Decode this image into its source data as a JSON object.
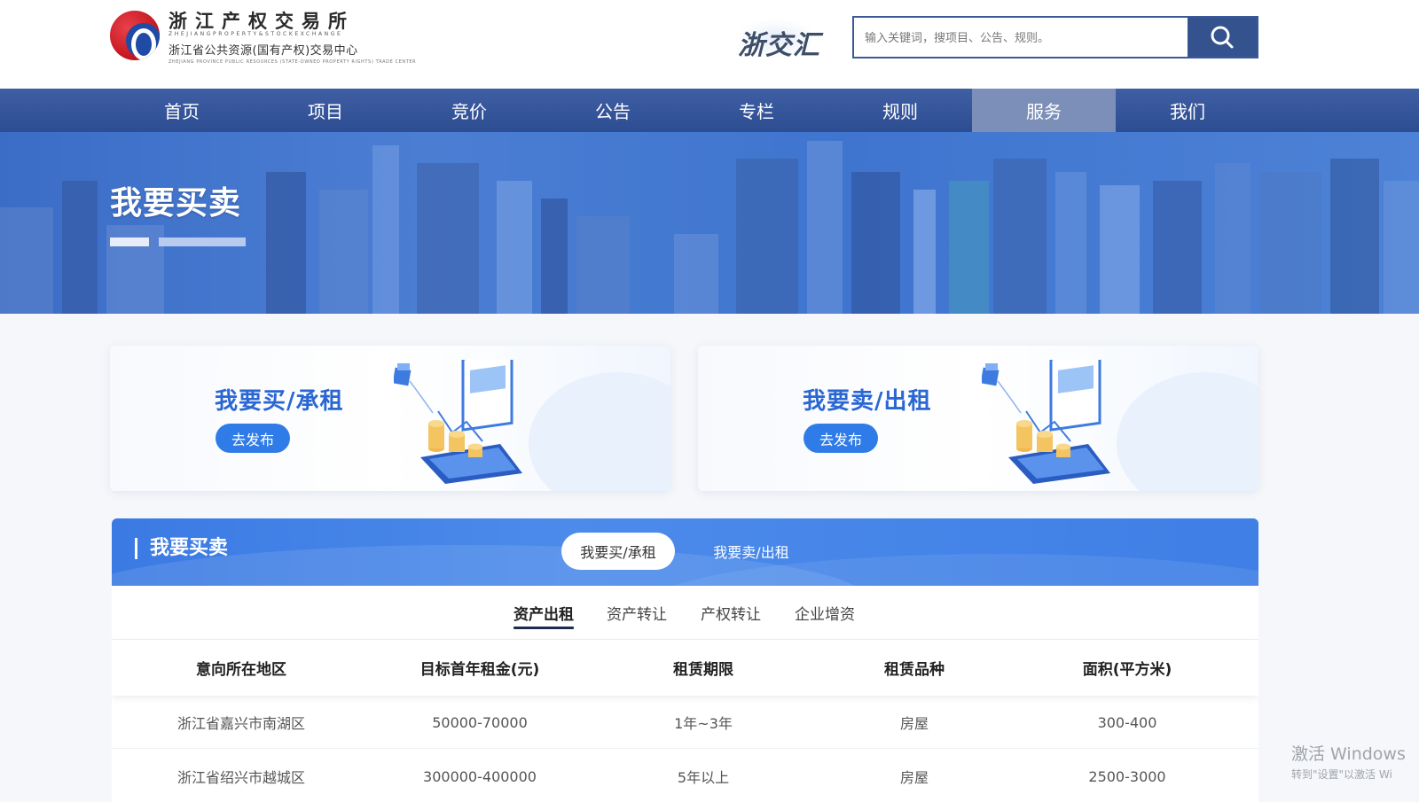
{
  "header": {
    "logo_cn": "浙江产权交易所",
    "logo_en": "ZHEJIANGPROPERTY&STOCKEXCHANGE",
    "logo_sub": "浙江省公共资源(国有产权)交易中心",
    "logo_sub_en": "ZHEJIANG PROVINCE PUBLIC RESOURCES (STATE-OWNED PROPERTY RIGHTS) TRADE CENTER",
    "brand": "浙交汇",
    "search_placeholder": "输入关键词，搜项目、公告、规则。"
  },
  "nav": {
    "items": [
      "首页",
      "项目",
      "竞价",
      "公告",
      "专栏",
      "规则",
      "服务",
      "我们"
    ],
    "active_index": 6
  },
  "banner": {
    "title": "我要买卖"
  },
  "cards": [
    {
      "title": "我要买/承租",
      "button": "去发布"
    },
    {
      "title": "我要卖/出租",
      "button": "去发布"
    }
  ],
  "panel": {
    "title": "我要买卖",
    "segments": [
      "我要买/承租",
      "我要卖/出租"
    ],
    "active_segment": 0,
    "sub_tabs": [
      "资产出租",
      "资产转让",
      "产权转让",
      "企业增资"
    ],
    "active_sub_tab": 0,
    "columns": [
      "意向所在地区",
      "目标首年租金(元)",
      "租赁期限",
      "租赁品种",
      "面积(平方米)"
    ],
    "rows": [
      [
        "浙江省嘉兴市南湖区",
        "50000-70000",
        "1年~3年",
        "房屋",
        "300-400"
      ],
      [
        "浙江省绍兴市越城区",
        "300000-400000",
        "5年以上",
        "房屋",
        "2500-3000"
      ]
    ]
  },
  "watermark": {
    "line1": "激活 Windows",
    "line2": "转到\"设置\"以激活 Wi"
  },
  "colors": {
    "nav_bg": "#2d4d93",
    "nav_active": "#7b8fb8",
    "accent_blue": "#2f7be8",
    "card_title": "#2a67d3",
    "search_btn": "#34528e"
  },
  "icons": {
    "search": "search-icon",
    "logo": "zjex-logo-icon",
    "card_illustration": "laptop-chart-coins-icon"
  }
}
